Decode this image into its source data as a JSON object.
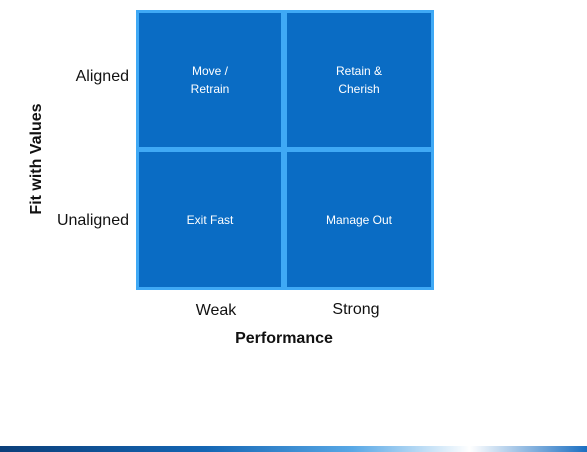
{
  "matrix": {
    "cells": {
      "top_left": "Move /\nRetrain",
      "top_right": "Retain &\nCherish",
      "bottom_left": "Exit Fast",
      "bottom_right": "Manage Out"
    },
    "rows": {
      "top": "Aligned",
      "bottom": "Unaligned"
    },
    "columns": {
      "left": "Weak",
      "right": "Strong"
    },
    "x_axis_title": "Performance",
    "y_axis_title": "Fit with Values"
  },
  "colors": {
    "cell_fill": "#0a6cc4",
    "grid_border": "#3fa9f5"
  }
}
